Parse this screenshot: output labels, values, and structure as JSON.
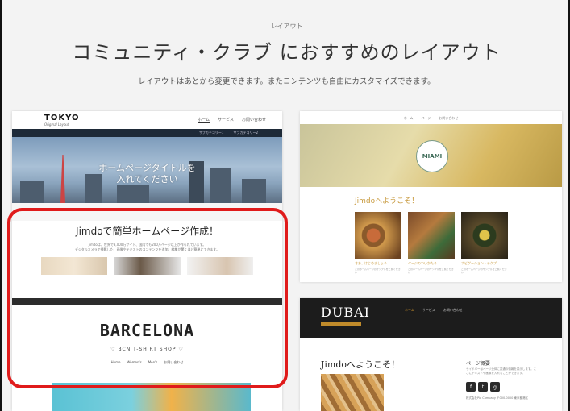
{
  "header": {
    "kicker": "レイアウト",
    "title": "コミュニティ・クラブ におすすめのレイアウト",
    "lead": "レイアウトはあとから変更できます。またコンテンツも自由にカスタマイズできます。"
  },
  "tokyo": {
    "logo": "TOKYO",
    "logo_sub": "Original Layout",
    "nav": [
      "ホーム",
      "サービス",
      "お問い合わせ"
    ],
    "subnav": [
      "サブカテゴリー1",
      "サブカテゴリー2"
    ],
    "hero_text_1": "ホームページタイトルを",
    "hero_text_2": "入れてください",
    "section_title": "Jimdoで簡単ホームページ作成！",
    "section_body_1": "Jimdoは、世界で3,000万サイト、国内でも200万ページ以上が作られています。",
    "section_body_2": "デジタルカメラで撮影した、画像やテキストのコンテンツを追加。編集が驚くほど簡単にできます。"
  },
  "barcelona": {
    "title": "BARCELONA",
    "subtitle": "♡ BCN T-SHIRT SHOP ♡",
    "nav": [
      "Home",
      "Women's",
      "Men's",
      "お問い合わせ"
    ]
  },
  "miami": {
    "nav": [
      "ホーム",
      "ページ",
      "お問い合わせ"
    ],
    "badge": "MIAMI",
    "welcome": "Jimdoへようこそ！",
    "dishes": [
      {
        "caption": "さあ、はじめましょう",
        "line": "このホームページのサンプルをご覧ください"
      },
      {
        "caption": "ページのついかたる",
        "line": "このホームページのサンプルをご覧ください"
      },
      {
        "caption": "ナビゲーション・テクプ",
        "line": "このホームページのサンプルをご覧ください"
      }
    ]
  },
  "dubai": {
    "logo": "DUBAI",
    "nav": [
      "ホーム",
      "サービス",
      "お問い合わせ"
    ],
    "welcome": "Jimdoへようこそ！",
    "side_title": "ページ概要",
    "side_text": "サイドバーはページ全体に共通の情報を表示します。ここにテキストや画像を入れることができます。",
    "social": [
      "f",
      "t",
      "g"
    ],
    "side_info": "株式会社Pia Company 〒000-0000 東京都港区"
  },
  "colors": {
    "highlight": "#e01b1b",
    "navy": "#1e2a38",
    "gold": "#c89a3e"
  }
}
